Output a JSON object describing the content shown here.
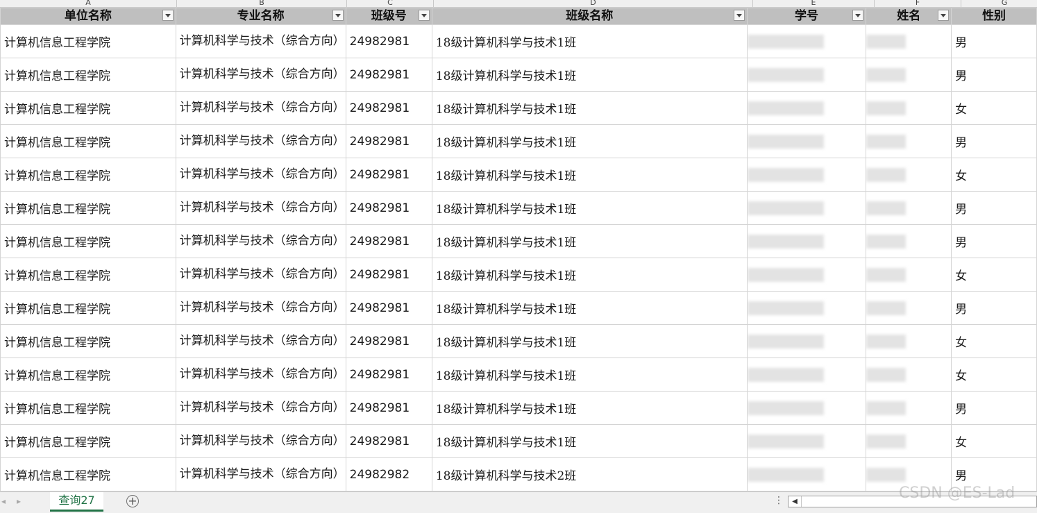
{
  "column_letters": [
    "A",
    "B",
    "C",
    "D",
    "E",
    "F",
    "G"
  ],
  "headers": [
    "单位名称",
    "专业名称",
    "班级号",
    "班级名称",
    "学号",
    "姓名",
    "性别"
  ],
  "rows": [
    {
      "unit": "计算机信息工程学院",
      "major": "计算机科学与技术（综合方向）",
      "class_no": "24982981",
      "class_name": "18级计算机科学与技术1班",
      "gender": "男"
    },
    {
      "unit": "计算机信息工程学院",
      "major": "计算机科学与技术（综合方向）",
      "class_no": "24982981",
      "class_name": "18级计算机科学与技术1班",
      "gender": "男"
    },
    {
      "unit": "计算机信息工程学院",
      "major": "计算机科学与技术（综合方向）",
      "class_no": "24982981",
      "class_name": "18级计算机科学与技术1班",
      "gender": "女"
    },
    {
      "unit": "计算机信息工程学院",
      "major": "计算机科学与技术（综合方向）",
      "class_no": "24982981",
      "class_name": "18级计算机科学与技术1班",
      "gender": "男"
    },
    {
      "unit": "计算机信息工程学院",
      "major": "计算机科学与技术（综合方向）",
      "class_no": "24982981",
      "class_name": "18级计算机科学与技术1班",
      "gender": "女"
    },
    {
      "unit": "计算机信息工程学院",
      "major": "计算机科学与技术（综合方向）",
      "class_no": "24982981",
      "class_name": "18级计算机科学与技术1班",
      "gender": "男"
    },
    {
      "unit": "计算机信息工程学院",
      "major": "计算机科学与技术（综合方向）",
      "class_no": "24982981",
      "class_name": "18级计算机科学与技术1班",
      "gender": "男"
    },
    {
      "unit": "计算机信息工程学院",
      "major": "计算机科学与技术（综合方向）",
      "class_no": "24982981",
      "class_name": "18级计算机科学与技术1班",
      "gender": "女"
    },
    {
      "unit": "计算机信息工程学院",
      "major": "计算机科学与技术（综合方向）",
      "class_no": "24982981",
      "class_name": "18级计算机科学与技术1班",
      "gender": "男"
    },
    {
      "unit": "计算机信息工程学院",
      "major": "计算机科学与技术（综合方向）",
      "class_no": "24982981",
      "class_name": "18级计算机科学与技术1班",
      "gender": "女"
    },
    {
      "unit": "计算机信息工程学院",
      "major": "计算机科学与技术（综合方向）",
      "class_no": "24982981",
      "class_name": "18级计算机科学与技术1班",
      "gender": "女"
    },
    {
      "unit": "计算机信息工程学院",
      "major": "计算机科学与技术（综合方向）",
      "class_no": "24982981",
      "class_name": "18级计算机科学与技术1班",
      "gender": "男"
    },
    {
      "unit": "计算机信息工程学院",
      "major": "计算机科学与技术（综合方向）",
      "class_no": "24982981",
      "class_name": "18级计算机科学与技术1班",
      "gender": "女"
    },
    {
      "unit": "计算机信息工程学院",
      "major": "计算机科学与技术（综合方向）",
      "class_no": "24982982",
      "class_name": "18级计算机科学与技术2班",
      "gender": "男"
    }
  ],
  "sheet_tab": "查询27",
  "watermark": "CSDN @ES-Lad",
  "icons": {
    "filter": "filter-dropdown-icon",
    "add_sheet": "plus-circle-icon",
    "add_sheet_glyph": "+",
    "nav_prev_glyph": "◂",
    "nav_next_glyph": "▸",
    "split_glyph": "⋮",
    "scroll_left_glyph": "◀"
  },
  "colors": {
    "header_bg": "#bfbfbf",
    "sheet_tab_accent": "#217346",
    "grid_line": "#d4d4d4"
  }
}
